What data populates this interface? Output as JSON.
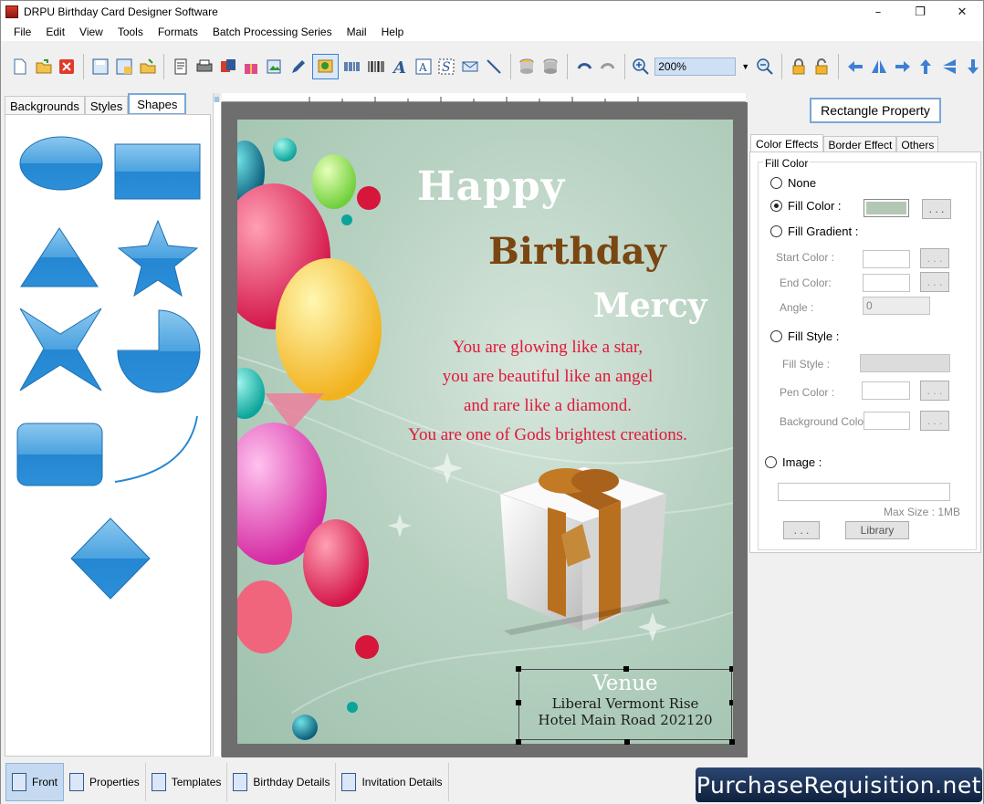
{
  "window": {
    "title": "DRPU Birthday Card Designer Software",
    "controls": [
      "–",
      "❐",
      "✕"
    ]
  },
  "menu": [
    "File",
    "Edit",
    "View",
    "Tools",
    "Formats",
    "Batch Processing Series",
    "Mail",
    "Help"
  ],
  "toolbar": {
    "zoom_value": "200%"
  },
  "left_tabs": [
    "Backgrounds",
    "Styles",
    "Shapes"
  ],
  "card": {
    "line1": "Happy",
    "line2": "Birthday",
    "line3": "Mercy",
    "verse": [
      "You are glowing like a star,",
      "you are beautiful like an angel",
      "and rare like a diamond.",
      "You are one of Gods brightest creations."
    ],
    "venue_title": "Venue",
    "venue_line1": "Liberal Vermont Rise",
    "venue_line2": "Hotel Main Road 202120"
  },
  "right_panel": {
    "title": "Rectangle Property",
    "tabs": [
      "Color Effects",
      "Border Effect",
      "Others"
    ],
    "group_label": "Fill Color",
    "opt_none": "None",
    "opt_fill_color": "Fill Color :",
    "opt_fill_gradient": "Fill Gradient :",
    "start_color": "Start Color :",
    "end_color": "End Color:",
    "angle": "Angle :",
    "angle_value": "0",
    "opt_fill_style": "Fill Style :",
    "fill_style": "Fill Style :",
    "pen_color": "Pen Color :",
    "background_color": "Background Color :",
    "opt_image": "Image :",
    "max_size": "Max Size : 1MB",
    "browse": ". . .",
    "library": "Library",
    "fill_swatch_color": "#b2c8b4"
  },
  "bottom_tabs": [
    "Front",
    "Properties",
    "Templates",
    "Birthday Details",
    "Invitation Details"
  ],
  "watermark": "PurchaseRequisition.net"
}
